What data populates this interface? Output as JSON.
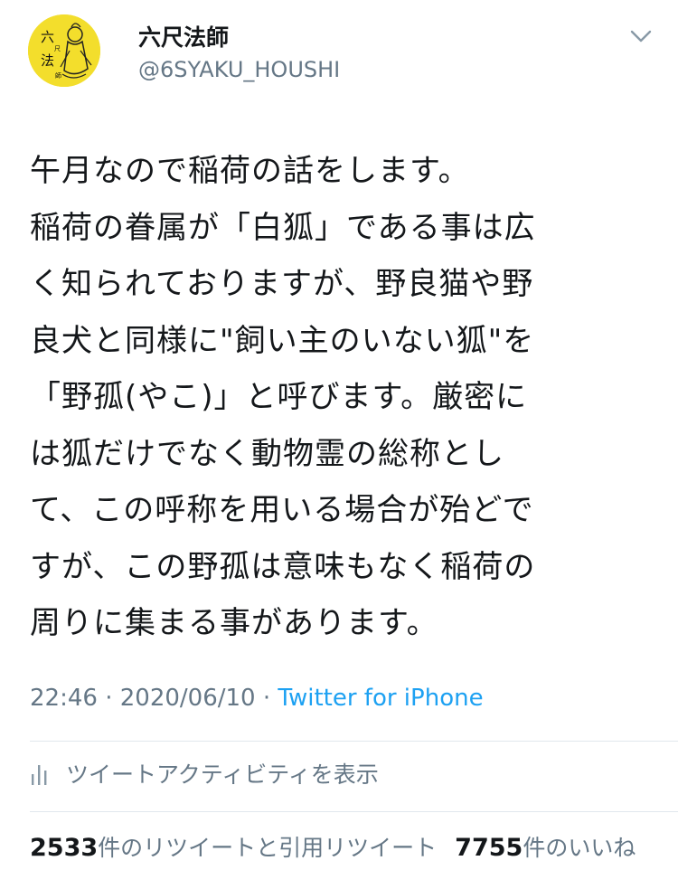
{
  "author": {
    "display_name": "六尺法師",
    "handle": "@6SYAKU_HOUSHI",
    "avatar_text": "六尺法師"
  },
  "tweet": {
    "lines": [
      "午月なので稲荷の話をします。",
      "稲荷の眷属が「白狐」である事は広",
      "く知られておりますが、野良猫や野",
      "良犬と同様に\"飼い主のいない狐\"を",
      "「野孤(やこ)」と呼びます。厳密に",
      "は狐だけでなく動物霊の総称とし",
      "て、この呼称を用いる場合が殆どで",
      "すが、この野孤は意味もなく稲荷の",
      "周りに集まる事があります。"
    ],
    "time": "22:46",
    "separator": "·",
    "date": "2020/06/10",
    "source": "Twitter for iPhone"
  },
  "activity": {
    "label": "ツイートアクティビティを表示",
    "icon": "bar-chart-icon"
  },
  "stats": {
    "retweets_count": "2533",
    "retweets_label": "件のリツイートと引用リツイート",
    "likes_count": "7755",
    "likes_label": "件のいいね"
  },
  "menu_icon": "chevron-down-icon",
  "colors": {
    "text": "#14171a",
    "secondary": "#657786",
    "link": "#1da1f2",
    "divider": "#e1e8ed",
    "avatar_bg": "#f3de2c"
  }
}
